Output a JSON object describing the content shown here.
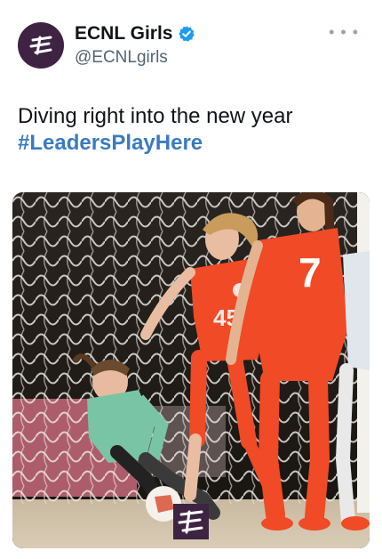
{
  "tweet": {
    "display_name": "ECNL Girls",
    "handle": "@ECNLgirls",
    "text_line": "Diving right into the new year",
    "hashtag": "#LeadersPlayHere",
    "more_icon": "more-dots-icon",
    "verified_icon": "verified-badge-icon"
  },
  "media": {
    "jersey_number_right": "7",
    "jersey_number_center": "45"
  },
  "colors": {
    "brand": "#3e2343",
    "verified": "#1d9bf0",
    "hashtag": "#3a7bbf",
    "jersey": "#f04a26"
  }
}
